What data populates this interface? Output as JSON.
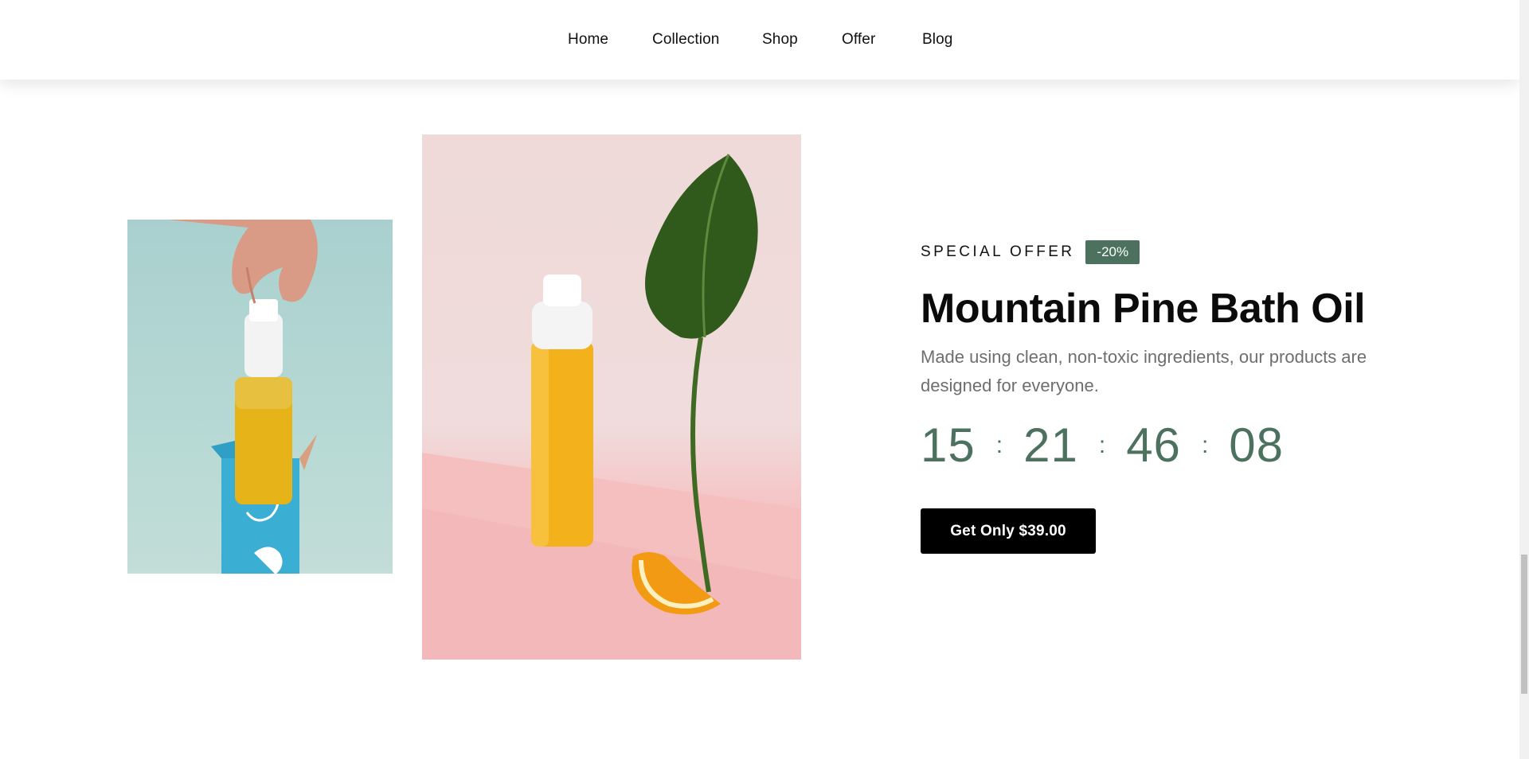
{
  "nav": {
    "items": [
      {
        "label": "Home"
      },
      {
        "label": "Collection"
      },
      {
        "label": "Shop"
      },
      {
        "label": "Offer"
      },
      {
        "label": "Blog"
      }
    ]
  },
  "offer": {
    "label": "SPECIAL OFFER",
    "badge": "-20%",
    "title": "Mountain Pine Bath Oil",
    "description": "Made using clean, non-toxic ingredients, our products are designed for everyone.",
    "countdown": {
      "days": "15",
      "hours": "21",
      "minutes": "46",
      "seconds": "08",
      "separator": ":"
    },
    "cta_label": "Get Only $39.00"
  },
  "images": {
    "small_alt": "hand lifting bottle from blue box",
    "large_alt": "bottle with leaf and orange slice"
  },
  "colors": {
    "accent": "#4c725f",
    "button": "#000000",
    "muted_text": "#6e6e6e"
  }
}
